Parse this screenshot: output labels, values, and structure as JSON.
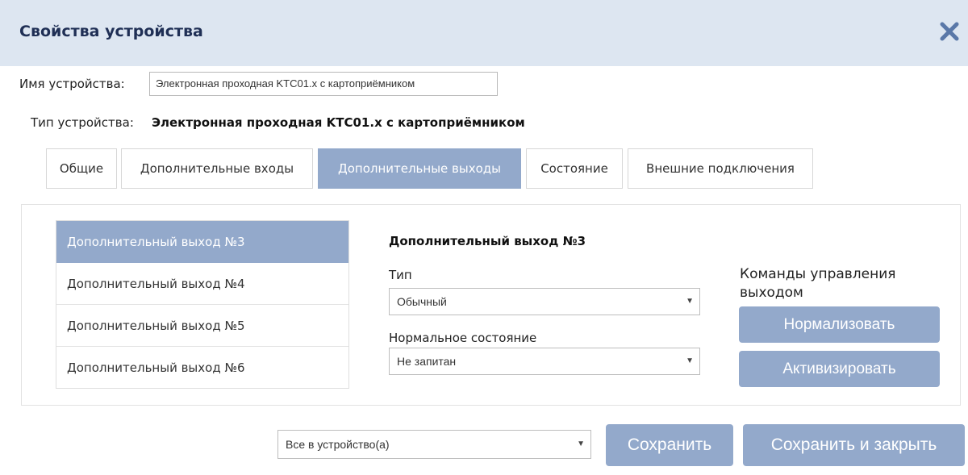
{
  "dialog": {
    "title": "Свойства устройства",
    "close_icon": "close-icon"
  },
  "device": {
    "name_label": "Имя устройства:",
    "name_value": "Электронная проходная KTC01.x с картоприёмником",
    "type_label": "Тип устройства:",
    "type_value": "Электронная проходная KTC01.x с картоприёмником"
  },
  "tabs": [
    {
      "label": "Общие",
      "active": false
    },
    {
      "label": "Дополнительные входы",
      "active": false
    },
    {
      "label": "Дополнительные выходы",
      "active": true
    },
    {
      "label": "Состояние",
      "active": false
    },
    {
      "label": "Внешние подключения",
      "active": false
    }
  ],
  "outputs": {
    "items": [
      {
        "label": "Дополнительный выход №3",
        "selected": true
      },
      {
        "label": "Дополнительный выход №4",
        "selected": false
      },
      {
        "label": "Дополнительный выход №5",
        "selected": false
      },
      {
        "label": "Дополнительный выход №6",
        "selected": false
      }
    ]
  },
  "detail": {
    "title": "Дополнительный выход №3",
    "type_label": "Тип",
    "type_value": "Обычный",
    "normal_state_label": "Нормальное состояние",
    "normal_state_value": "Не запитан"
  },
  "commands": {
    "label": "Команды управления выходом",
    "normalize": "Нормализовать",
    "activate": "Активизировать"
  },
  "footer": {
    "apply_target": "Все в устройство(а)",
    "save": "Сохранить",
    "save_close": "Сохранить и закрыть"
  },
  "colors": {
    "header_bg": "#dde6f1",
    "accent": "#93a9cb",
    "title_text": "#1f2f55",
    "close_icon": "#5a78a8"
  }
}
